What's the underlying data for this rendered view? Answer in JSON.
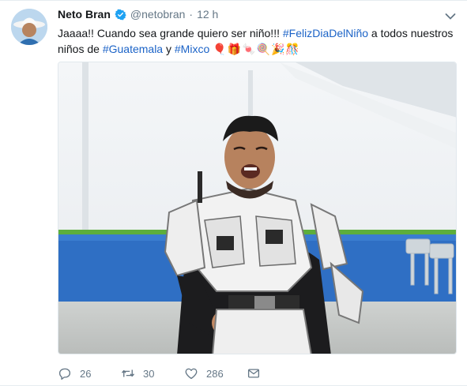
{
  "tweet": {
    "author_name": "Neto Bran",
    "handle": "@netobran",
    "separator": "·",
    "time": "12 h",
    "text_segments": [
      {
        "text": "Jaaaa!! Cuando sea grande quiero ser niño!!! ",
        "type": "text"
      },
      {
        "text": "#FelizDiaDelNiño",
        "type": "hashtag"
      },
      {
        "text": " a todos nuestros niños de ",
        "type": "text"
      },
      {
        "text": "#Guatemala",
        "type": "hashtag"
      },
      {
        "text": " y ",
        "type": "text"
      },
      {
        "text": "#Mixco",
        "type": "hashtag"
      }
    ],
    "emojis": "🎈🎁🍬🍭🎉🎊",
    "media": {
      "icon": "photo-armor-costume"
    },
    "actions": {
      "reply_count": "26",
      "retweet_count": "30",
      "like_count": "286"
    }
  },
  "icons": {
    "verified": "verified-badge-icon",
    "caret": "chevron-down-icon",
    "reply": "reply-icon",
    "retweet": "retweet-icon",
    "like": "heart-icon",
    "dm": "envelope-icon"
  },
  "colors": {
    "accent": "#1da1f2",
    "hashtag": "#1b63c7",
    "muted": "#657786",
    "text": "#14171a"
  }
}
